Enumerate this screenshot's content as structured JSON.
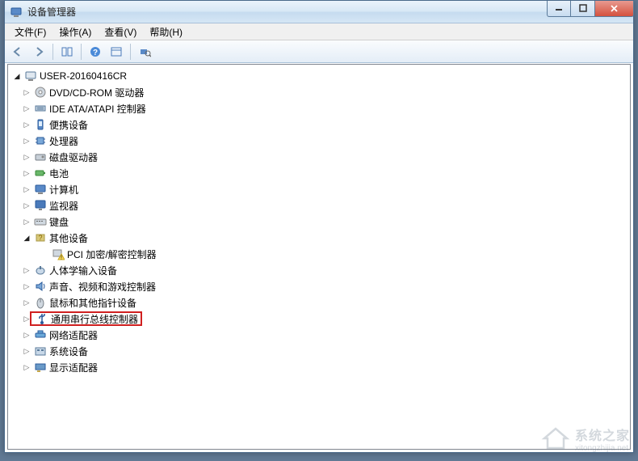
{
  "window": {
    "title": "设备管理器"
  },
  "menubar": {
    "file": "文件(F)",
    "action": "操作(A)",
    "view": "查看(V)",
    "help": "帮助(H)"
  },
  "tree": {
    "root": "USER-20160416CR",
    "items": [
      {
        "label": "DVD/CD-ROM 驱动器",
        "icon": "disc-drive-icon",
        "expanded": false
      },
      {
        "label": "IDE ATA/ATAPI 控制器",
        "icon": "ide-controller-icon",
        "expanded": false
      },
      {
        "label": "便携设备",
        "icon": "portable-device-icon",
        "expanded": false
      },
      {
        "label": "处理器",
        "icon": "processor-icon",
        "expanded": false
      },
      {
        "label": "磁盘驱动器",
        "icon": "disk-drive-icon",
        "expanded": false
      },
      {
        "label": "电池",
        "icon": "battery-icon",
        "expanded": false
      },
      {
        "label": "计算机",
        "icon": "computer-icon",
        "expanded": false
      },
      {
        "label": "监视器",
        "icon": "monitor-icon",
        "expanded": false
      },
      {
        "label": "键盘",
        "icon": "keyboard-icon",
        "expanded": false
      },
      {
        "label": "其他设备",
        "icon": "other-device-icon",
        "expanded": true,
        "children": [
          {
            "label": "PCI 加密/解密控制器",
            "icon": "warning-device-icon"
          }
        ]
      },
      {
        "label": "人体学输入设备",
        "icon": "hid-icon",
        "expanded": false
      },
      {
        "label": "声音、视频和游戏控制器",
        "icon": "sound-icon",
        "expanded": false
      },
      {
        "label": "鼠标和其他指针设备",
        "icon": "mouse-icon",
        "expanded": false
      },
      {
        "label": "通用串行总线控制器",
        "icon": "usb-icon",
        "expanded": false,
        "highlighted": true
      },
      {
        "label": "网络适配器",
        "icon": "network-icon",
        "expanded": false
      },
      {
        "label": "系统设备",
        "icon": "system-device-icon",
        "expanded": false
      },
      {
        "label": "显示适配器",
        "icon": "display-adapter-icon",
        "expanded": false
      }
    ]
  },
  "watermark": {
    "brand": "系统之家",
    "url": "xitongzhijia.net"
  }
}
